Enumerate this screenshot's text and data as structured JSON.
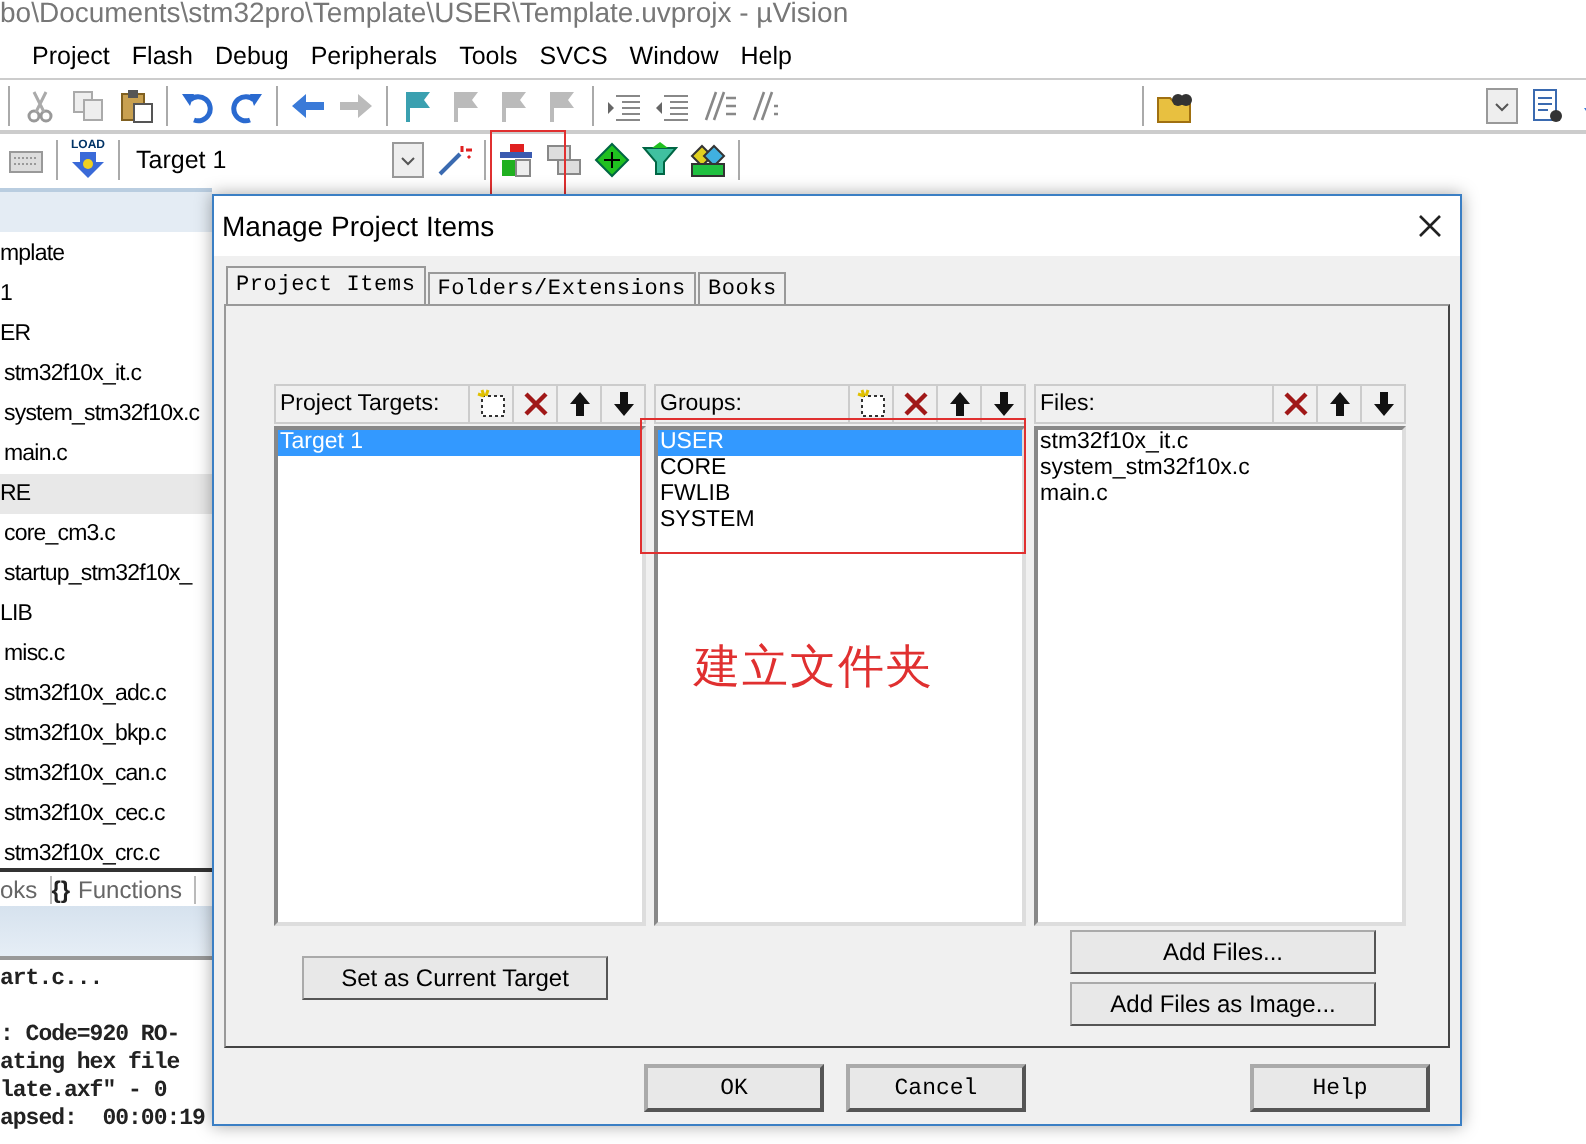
{
  "window": {
    "title": "bo\\Documents\\stm32pro\\Template\\USER\\Template.uvprojx - µVision"
  },
  "menu": [
    "Project",
    "Flash",
    "Debug",
    "Peripherals",
    "Tools",
    "SVCS",
    "Window",
    "Help"
  ],
  "toolbar": {
    "load_label": "LOAD",
    "target": "Target 1"
  },
  "project_tree": [
    {
      "label": "mplate",
      "selected": false,
      "children": [
        {
          "label": "1",
          "selected": false,
          "children": [
            {
              "label": "ER",
              "selected": false,
              "children": [
                {
                  "label": "stm32f10x_it.c",
                  "selected": false
                },
                {
                  "label": "system_stm32f10x.c",
                  "selected": false
                },
                {
                  "label": "main.c",
                  "selected": false
                }
              ]
            },
            {
              "label": "RE",
              "selected": true,
              "children": [
                {
                  "label": "core_cm3.c",
                  "selected": false
                },
                {
                  "label": "startup_stm32f10x_",
                  "selected": false
                }
              ]
            },
            {
              "label": "LIB",
              "selected": false,
              "children": [
                {
                  "label": "misc.c",
                  "selected": false
                },
                {
                  "label": "stm32f10x_adc.c",
                  "selected": false
                },
                {
                  "label": "stm32f10x_bkp.c",
                  "selected": false
                },
                {
                  "label": "stm32f10x_can.c",
                  "selected": false
                },
                {
                  "label": "stm32f10x_cec.c",
                  "selected": false
                },
                {
                  "label": "stm32f10x_crc.c",
                  "selected": false
                }
              ]
            }
          ]
        }
      ]
    }
  ],
  "panel_tabs": [
    {
      "label": "oks"
    },
    {
      "icon": "{}",
      "label": "Functions"
    }
  ],
  "output": [
    "art.c...",
    ": Code=920 RO-",
    "ating hex file",
    "late.axf\" - 0",
    "apsed:  00:00:19"
  ],
  "dialog": {
    "title": "Manage Project Items",
    "tabs": [
      {
        "label": "Project Items",
        "selected": true
      },
      {
        "label": "Folders/Extensions",
        "selected": false
      },
      {
        "label": "Books",
        "selected": false
      }
    ],
    "lists": [
      {
        "title": "Project Targets:",
        "new_button": true,
        "items": [
          {
            "label": "Target 1",
            "selected": true
          }
        ]
      },
      {
        "title": "Groups:",
        "new_button": true,
        "items": [
          {
            "label": "USER",
            "selected": true
          },
          {
            "label": "CORE",
            "selected": false
          },
          {
            "label": "FWLIB",
            "selected": false
          },
          {
            "label": "SYSTEM",
            "selected": false
          }
        ]
      },
      {
        "title": "Files:",
        "new_button": false,
        "items": [
          {
            "label": "stm32f10x_it.c",
            "selected": false
          },
          {
            "label": "system_stm32f10x.c",
            "selected": false
          },
          {
            "label": "main.c",
            "selected": false
          }
        ]
      }
    ],
    "target_button": "Set as Current Target",
    "file_buttons": [
      "Add Files...",
      "Add Files as Image..."
    ],
    "footer_buttons": [
      "OK",
      "Cancel",
      "Help"
    ],
    "annotation": "建立文件夹"
  }
}
